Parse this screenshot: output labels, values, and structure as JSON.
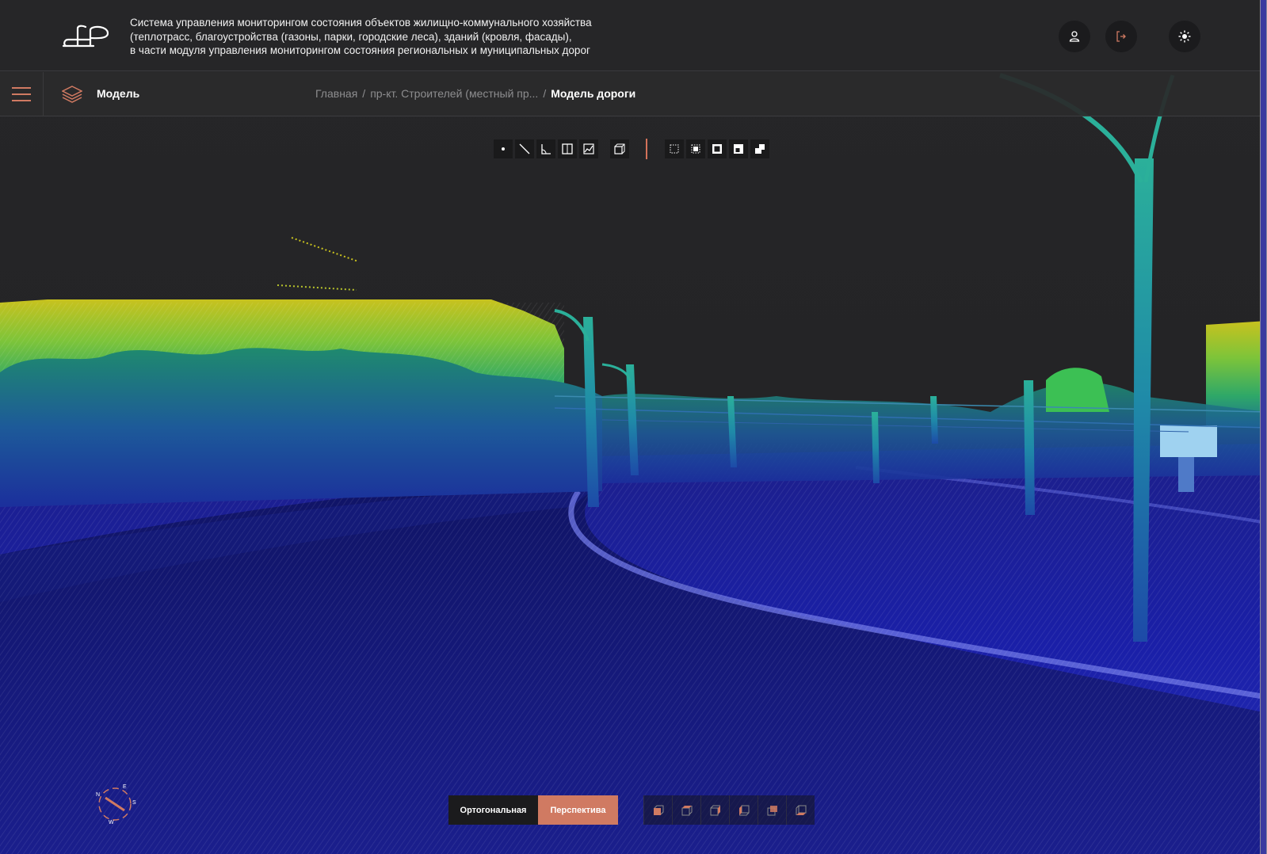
{
  "header": {
    "title_lines": [
      "Система управления мониторингом состояния объектов жилищно-коммунального хозяйства",
      "(теплотрасс, благоустройства (газоны, парки, городские леса), зданий (кровля, фасады),",
      "в части модуля управления мониторингом состояния региональных и муниципальных дорог"
    ],
    "buttons": {
      "user_icon": "user-icon",
      "logout_icon": "logout-icon",
      "theme_icon": "sun-icon"
    }
  },
  "subheader": {
    "section_label": "Модель",
    "breadcrumb": {
      "home": "Главная",
      "parent": "пр-кт. Строителей (местный пр...",
      "separator": "/",
      "current": "Модель дороги"
    }
  },
  "tools": {
    "measure": [
      "point-icon",
      "distance-icon",
      "angle-icon",
      "area-icon",
      "height-profile-icon"
    ],
    "clip": [
      "clip-volume-icon"
    ],
    "selection": [
      "select-none-icon",
      "select-inside-icon",
      "select-outside-icon",
      "select-highlight-icon",
      "select-remove-icon"
    ]
  },
  "projection": {
    "ortho_label": "Ортогональная",
    "persp_label": "Перспектива",
    "active": "persp"
  },
  "views": [
    "front-view-icon",
    "top-view-icon",
    "right-view-icon",
    "left-view-icon",
    "back-view-icon",
    "bottom-view-icon"
  ],
  "compass": {
    "labels": [
      "N",
      "E",
      "S",
      "W"
    ]
  },
  "colors": {
    "accent": "#d07a62",
    "header_bg": "#262628",
    "scene_bg": "#232325"
  }
}
